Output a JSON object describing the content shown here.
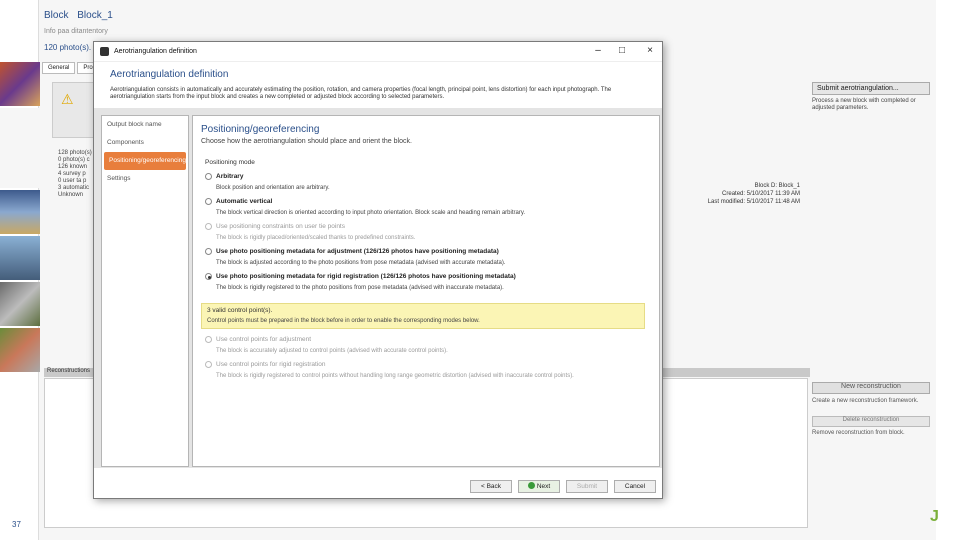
{
  "background": {
    "breadcrumb": [
      "Block",
      "Block_1"
    ],
    "subcrumb": "Info paa ditantentory",
    "photo_count": "120 photo(s).",
    "tabs": [
      "General",
      "Pro"
    ],
    "info_lines": [
      "128 photo(s)",
      "0 photo(s) c",
      "126 known",
      "4 survey p",
      "0 user ta p",
      "3 automatic",
      "Unknown"
    ],
    "right_info": [
      "Block D: Block_1",
      "Created: 5/10/2017 11:39 AM",
      "Last modified: 5/10/2017 11:48 AM"
    ],
    "submit_label": "Submit aerotriangulation...",
    "submit_note": "Process a new block with completed or adjusted parameters.",
    "recon_bar": "Reconstructions",
    "new_recon_label": "New reconstruction",
    "new_recon_note": "Create a new reconstruction framework.",
    "del_recon_label": "Delete reconstruction",
    "del_recon_note": "Remove reconstruction from block.",
    "slide_number": "37"
  },
  "dialog": {
    "title": "Aerotriangulation definition",
    "heading": "Aerotriangulation definition",
    "description": "Aerotriangulation consists in automatically and accurately estimating the position, rotation, and camera properties (focal length, principal point, lens distortion) for each input photograph. The aerotriangulation starts from the input block and creates a new completed or adjusted block according to selected parameters.",
    "steps": [
      "Output block name",
      "Components",
      "Positioning/georeferencing",
      "Settings"
    ],
    "section_title": "Positioning/georeferencing",
    "section_sub": "Choose how the aerotriangulation should place and orient the block.",
    "mode_label": "Positioning mode",
    "options": [
      {
        "label": "Arbitrary",
        "desc": "Block position and orientation are arbitrary."
      },
      {
        "label": "Automatic vertical",
        "desc": "The block vertical direction is oriented according to input photo orientation. Block scale and heading remain arbitrary."
      },
      {
        "label": "Use positioning constraints on user tie points",
        "desc": "The block is rigidly placed/oriented/scaled thanks to predefined constraints."
      },
      {
        "label": "Use photo positioning metadata for adjustment (126/126 photos have positioning metadata)",
        "desc": "The block is adjusted according to the photo positions from pose metadata (advised with accurate metadata)."
      },
      {
        "label": "Use photo positioning metadata for rigid registration (126/126 photos have positioning metadata)",
        "desc": "The block is rigidly registered to the photo positions from pose metadata (advised with inaccurate metadata)."
      },
      {
        "label": "Use control points for adjustment",
        "desc": "The block is accurately adjusted to control points (advised with accurate control points)."
      },
      {
        "label": "Use control points for rigid registration",
        "desc": "The block is rigidly registered to control points without handling long range geometric distortion (advised with inaccurate control points)."
      }
    ],
    "cp_title": "3 valid control point(s).",
    "cp_note": "Control points must be prepared in the block before in order to enable the corresponding modes below.",
    "buttons": {
      "back": "< Back",
      "next": "Next",
      "submit": "Submit",
      "cancel": "Cancel"
    }
  }
}
